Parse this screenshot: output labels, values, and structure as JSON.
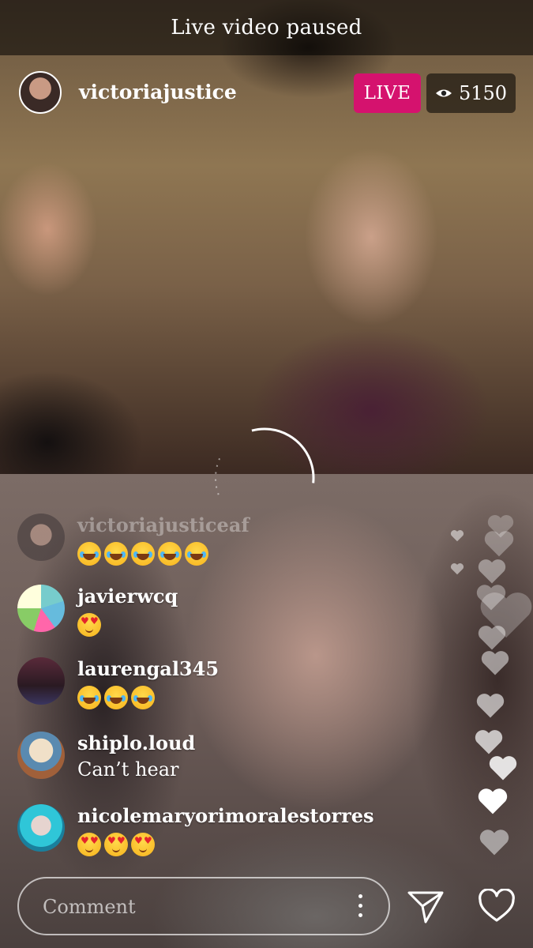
{
  "status_banner": "Live video paused",
  "host": {
    "username": "victoriajustice"
  },
  "live_label": "LIVE",
  "viewer_count": "5150",
  "comments": [
    {
      "user": "victoriajusticeaf",
      "text": ""
    },
    {
      "user": "javierwcq",
      "text": ""
    },
    {
      "user": "laurengal345",
      "text": ""
    },
    {
      "user": "shiplo.loud",
      "text": "Can’t hear"
    },
    {
      "user": "nicolemaryorimoralestorres",
      "text": ""
    }
  ],
  "comment_input": {
    "placeholder": "Comment"
  },
  "icons": {
    "viewers": "eye-icon",
    "send": "paper-plane-icon",
    "like": "heart-outline-icon",
    "more": "vertical-dots-icon"
  },
  "colors": {
    "live_badge": "#d5126e"
  }
}
